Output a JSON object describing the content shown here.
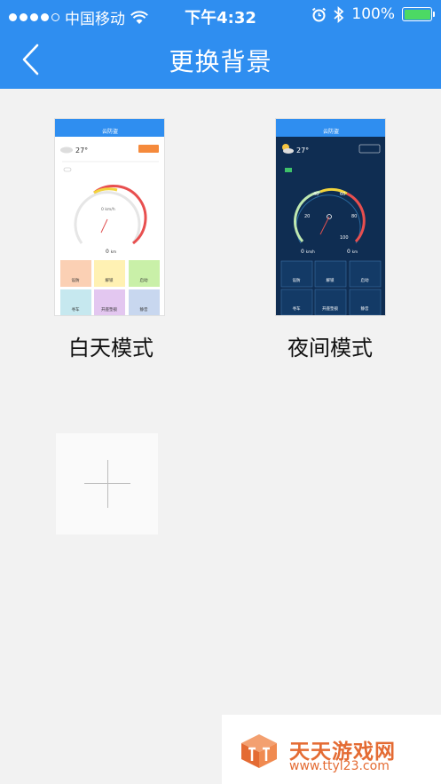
{
  "status_bar": {
    "carrier": "中国移动",
    "time": "下午4:32",
    "battery": "100%",
    "battery_level": 1.0
  },
  "nav": {
    "title": "更换背景",
    "back_icon": "chevron-left-icon"
  },
  "backgrounds": [
    {
      "label": "白天模式",
      "preview": {
        "app_title": "云防盗",
        "temp": "27°",
        "speed_unit": "km/h",
        "speed": "0",
        "mileage_unit": "km",
        "mileage": "0",
        "buttons": [
          "设防",
          "解锁",
          "启动",
          "寻车",
          "开座垫锁",
          "静音"
        ]
      }
    },
    {
      "label": "夜间模式",
      "preview": {
        "app_title": "云防盗",
        "temp": "27°",
        "speed_unit": "km/h",
        "speed": "0",
        "mileage_unit": "km",
        "mileage": "0",
        "gauge_ticks": [
          "20",
          "40",
          "60",
          "80",
          "100"
        ],
        "buttons": [
          "设防",
          "解锁",
          "启动",
          "寻车",
          "开座垫锁",
          "静音"
        ]
      }
    }
  ],
  "add_background": {
    "icon": "plus-icon"
  },
  "watermark": {
    "name": "天天游戏网",
    "url": "www.ttyl23.com"
  },
  "colors": {
    "header": "#2f8ef0",
    "background": "#f2f2f2",
    "battery_fill": "#4cd964",
    "watermark": "#e46b33"
  }
}
